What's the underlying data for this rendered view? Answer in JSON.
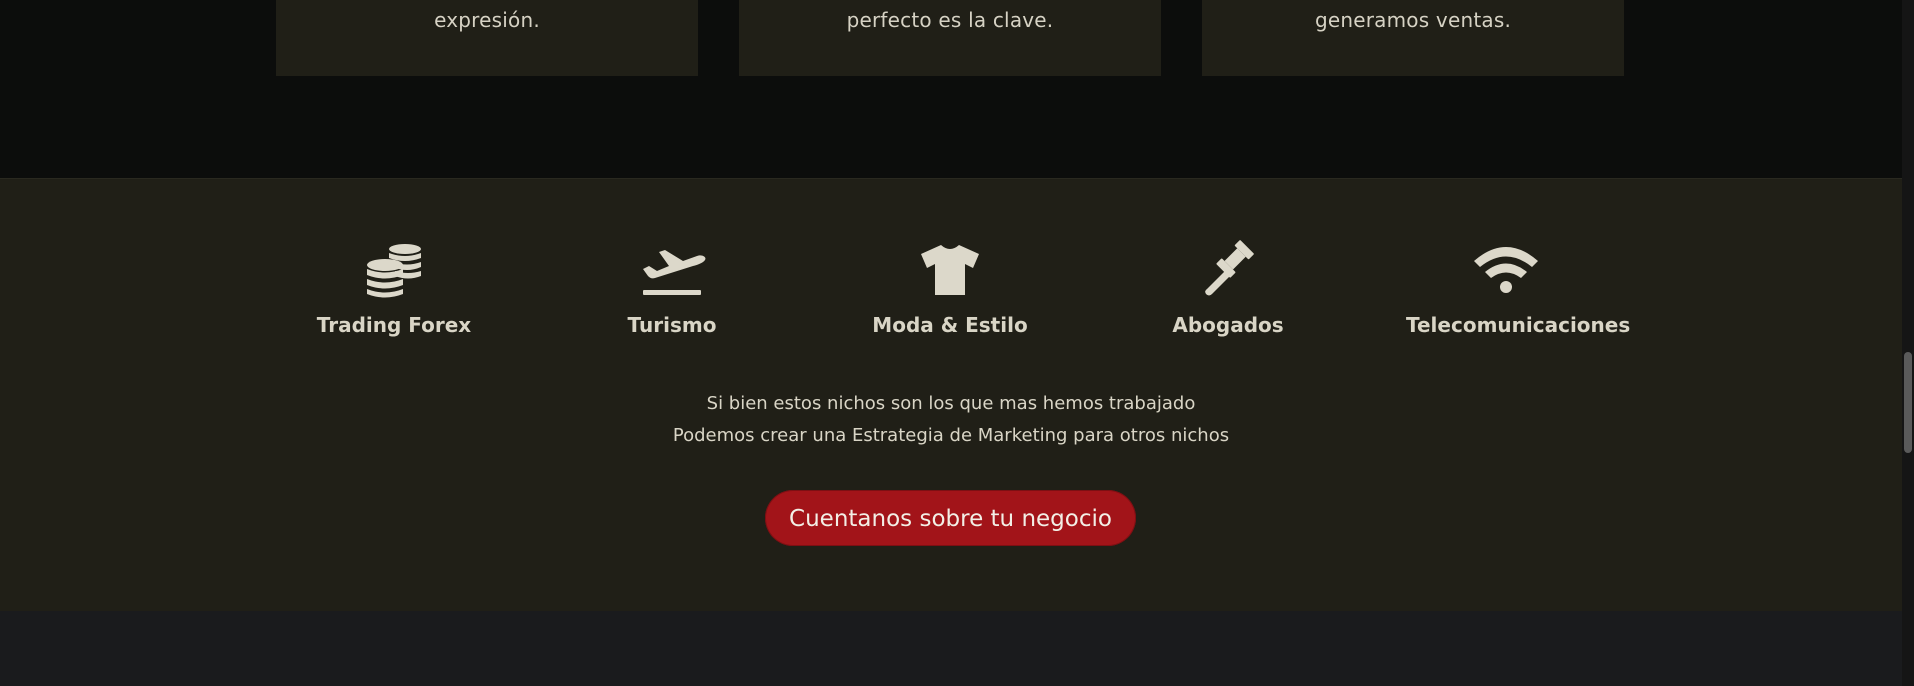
{
  "cards": [
    {
      "text": "expresión."
    },
    {
      "text": "perfecto es la clave."
    },
    {
      "text": "generamos ventas."
    }
  ],
  "niches": [
    {
      "label": "Trading Forex",
      "icon": "coins-icon"
    },
    {
      "label": "Turismo",
      "icon": "plane-departure-icon"
    },
    {
      "label": "Moda & Estilo",
      "icon": "tshirt-icon"
    },
    {
      "label": "Abogados",
      "icon": "gavel-icon"
    },
    {
      "label": "Telecomunicaciones",
      "icon": "wifi-icon"
    }
  ],
  "note": {
    "line1": "Si bien estos nichos son los que mas hemos trabajado",
    "line2": "Podemos crear una Estrategia de Marketing para otros nichos"
  },
  "cta": {
    "label": "Cuentanos sobre tu negocio"
  },
  "colors": {
    "background_dark": "#0c0d0c",
    "panel": "#201f17",
    "text": "#d9d5c6",
    "accent": "#a21419",
    "bottom": "#1a1b1d"
  }
}
